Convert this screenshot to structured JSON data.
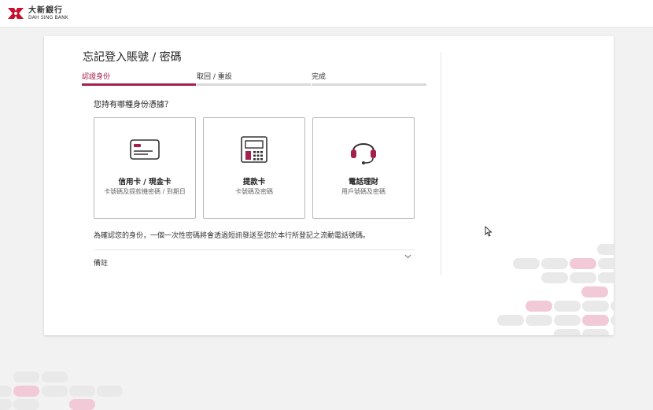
{
  "brand": {
    "name_cn": "大新銀行",
    "name_en": "DAH SING BANK",
    "color": "#c8102e"
  },
  "page": {
    "title": "忘記登入賬號 / 密碼"
  },
  "steps": [
    {
      "label": "認證身份",
      "active": true
    },
    {
      "label": "取回 / 重設",
      "active": false
    },
    {
      "label": "完成",
      "active": false
    }
  ],
  "question": "您持有哪種身份憑據？",
  "options": [
    {
      "icon": "credit-card-icon",
      "title": "信用卡 / 現金卡",
      "subtitle": "卡號碼及提款機密碼 / 到期日"
    },
    {
      "icon": "atm-icon",
      "title": "提款卡",
      "subtitle": "卡號碼及密碼"
    },
    {
      "icon": "headset-icon",
      "title": "電話理財",
      "subtitle": "用戶號碼及密碼"
    }
  ],
  "note": "為確認您的身份，一個一次性密碼將會透過短訊發送至您於本行所登記之流動電話號碼。",
  "remarks": {
    "label": "備註"
  },
  "colors": {
    "accent": "#a3214a",
    "pill_grey": "#e9e9e9",
    "pill_pink": "#f2c9d6"
  }
}
